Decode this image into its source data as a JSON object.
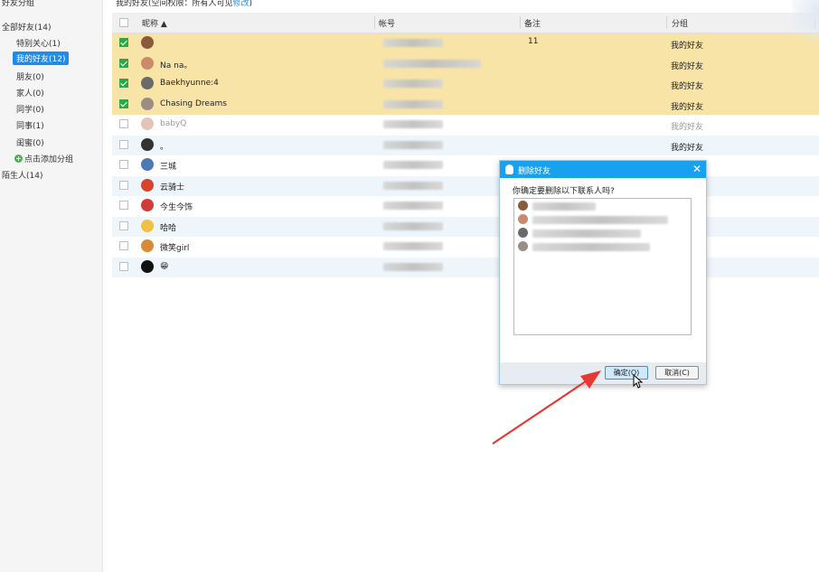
{
  "sidebar": {
    "title": "好友分组",
    "items": [
      {
        "label": "全部好友(14)",
        "root": true
      },
      {
        "label": "特别关心(1)"
      },
      {
        "label": "我的好友(12)",
        "active": true
      },
      {
        "label": "朋友(0)"
      },
      {
        "label": "家人(0)"
      },
      {
        "label": "同学(0)"
      },
      {
        "label": "同事(1)"
      },
      {
        "label": "闺蜜(0)"
      }
    ],
    "add_group_label": "点击添加分组",
    "stranger_label": "陌生人(14)"
  },
  "top_hint": {
    "text": "我的好友(空间权限：所有人可见",
    "link": "修改",
    "close": ")"
  },
  "table": {
    "columns": {
      "nick": "昵称 ▲",
      "account": "帐号",
      "remark": "备注",
      "group": "分组"
    },
    "rows": [
      {
        "name": "",
        "remark": "11",
        "group": "我的好友",
        "checked": true,
        "style": "selected",
        "avatar_color": "#8a5a3a",
        "acct_w": 66
      },
      {
        "name": "Na na。",
        "remark": "",
        "group": "我的好友",
        "checked": true,
        "style": "selected",
        "avatar_color": "#c98b6b",
        "acct_w": 108
      },
      {
        "name": "Baekhyunne:4",
        "remark": "",
        "group": "我的好友",
        "checked": true,
        "style": "selected",
        "avatar_color": "#6a6a6a",
        "acct_w": 66
      },
      {
        "name": "Chasing Dreams",
        "remark": "",
        "group": "我的好友",
        "checked": true,
        "style": "selected",
        "avatar_color": "#9a8e84",
        "acct_w": 66
      },
      {
        "name": "babyQ",
        "remark": "",
        "group": "我的好友",
        "checked": false,
        "style": "white",
        "faded": true,
        "avatar_color": "#e4c3b9",
        "acct_w": 66
      },
      {
        "name": "。",
        "remark": "",
        "group": "我的好友",
        "checked": false,
        "style": "alt",
        "avatar_color": "#333333",
        "acct_w": 66
      },
      {
        "name": "三城",
        "remark": "",
        "group": "",
        "checked": false,
        "style": "white",
        "avatar_color": "#4d7ab3",
        "acct_w": 66
      },
      {
        "name": "云骑士",
        "remark": "",
        "group": "",
        "checked": false,
        "style": "alt",
        "avatar_color": "#d9432e",
        "acct_w": 66
      },
      {
        "name": "今生今饰",
        "remark": "",
        "group": "",
        "checked": false,
        "style": "white",
        "avatar_color": "#d33b3b",
        "acct_w": 66
      },
      {
        "name": "哈哈",
        "remark": "",
        "group": "",
        "checked": false,
        "style": "alt",
        "avatar_color": "#f0c040",
        "acct_w": 66
      },
      {
        "name": "微笑girl",
        "remark": "",
        "group": "",
        "checked": false,
        "style": "white",
        "avatar_color": "#d88a3a",
        "acct_w": 66
      },
      {
        "name": "😁",
        "remark": "",
        "group": "",
        "checked": false,
        "style": "alt",
        "avatar_color": "#111111",
        "acct_w": 66
      }
    ]
  },
  "dialog": {
    "title": "删除好友",
    "question": "你确定要删除以下联系人吗?",
    "close": "✕",
    "confirm": "确定(O)",
    "cancel": "取消(C)",
    "contacts": [
      {
        "avatar_color": "#8a5a3a",
        "w": 70
      },
      {
        "avatar_color": "#c98b6b",
        "w": 150
      },
      {
        "avatar_color": "#6a6a6a",
        "w": 120
      },
      {
        "avatar_color": "#9a8e84",
        "w": 130
      }
    ]
  },
  "colors": {
    "accent": "#1f8ceb",
    "selected_row": "#f8e4a6",
    "arrow": "#e53935"
  }
}
